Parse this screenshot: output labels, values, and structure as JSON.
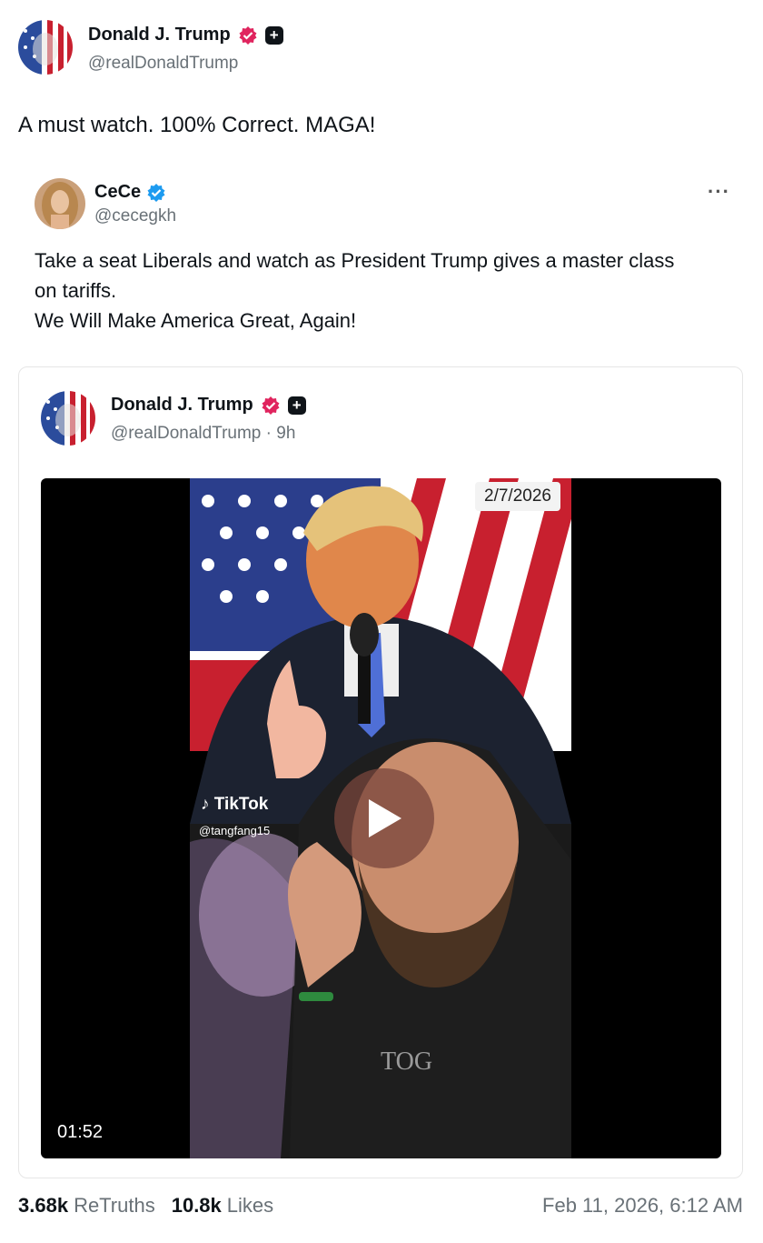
{
  "post": {
    "author_name": "Donald J. Trump",
    "author_handle": "@realDonaldTrump",
    "text": "A must watch. 100% Correct. MAGA!",
    "verified_badge_color": "#e0245e",
    "plus_badge_label": "+"
  },
  "quote": {
    "author_name": "CeCe",
    "author_handle": "@cecegkh",
    "more_icon": "···",
    "verified_badge_color": "#1d9bf0",
    "text_lines": [
      "Take a seat Liberals and watch as President Trump gives a master class",
      "on tariffs.",
      "We Will Make America Great, Again!"
    ]
  },
  "embedded": {
    "author_name": "Donald J. Trump",
    "author_handle": "@realDonaldTrump",
    "time_ago": "· 9h",
    "plus_badge_label": "+",
    "video": {
      "date_stamp": "2/7/2026",
      "tiktok_label": "♪ TikTok",
      "tiktok_handle": "@tangfang15",
      "duration": "01:52",
      "play_icon": "play-icon"
    }
  },
  "stats": {
    "retruths_count": "3.68k",
    "retruths_label": "ReTruths",
    "likes_count": "10.8k",
    "likes_label": "Likes",
    "timestamp": "Feb 11, 2026, 6:12 AM"
  }
}
